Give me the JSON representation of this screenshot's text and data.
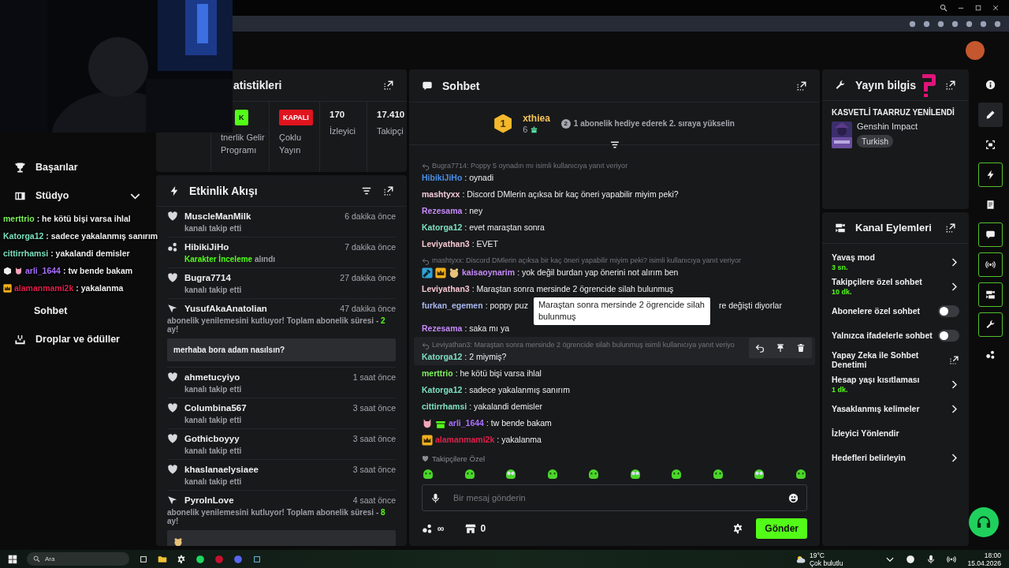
{
  "sidebar": {
    "items": [
      {
        "kind": "link",
        "label": "Başarılar"
      },
      {
        "kind": "group",
        "label": "Stüdyo",
        "expanded": false
      },
      {
        "kind": "subitem",
        "label": "Sohbet"
      },
      {
        "kind": "link",
        "label": "Droplar ve ödüller"
      }
    ]
  },
  "stream_overlay": {
    "lines": [
      {
        "user": "merttrio",
        "color": "#7cf25a",
        "text": " : he kötü bişi varsa ihlal"
      },
      {
        "user": "Katorga12",
        "color": "#7ee0c0",
        "text": " : sadece yakalanmış sanırım"
      },
      {
        "user": "cittirrhamsi",
        "color": "#7ee0c0",
        "text": " : yakalandi demisler"
      },
      {
        "badges": [
          {
            "kind": "cube"
          },
          {
            "kind": "sub"
          }
        ],
        "user": "arli_1644",
        "color": "#a970ff",
        "text": " : tw bende bakam"
      },
      {
        "badges": [
          {
            "kind": "vip"
          }
        ],
        "user": "alamanmami2k",
        "color": "#e0204a",
        "text": " : yakalanma"
      }
    ]
  },
  "stats": {
    "title": "atistikleri",
    "items": [
      {
        "kind": "badge",
        "value": "K",
        "color": "#53fc18",
        "label": "tnerlik Gelir Programı"
      },
      {
        "kind": "badge",
        "value": "KAPALI",
        "color": "#e0141e",
        "label": "Çoklu Yayın"
      },
      {
        "kind": "number",
        "value": "170",
        "label": "İzleyici"
      },
      {
        "kind": "number",
        "value": "17.410",
        "label": "Takipçi"
      }
    ]
  },
  "activity": {
    "title": "Etkinlik Akışı",
    "items": [
      {
        "kind": "follow",
        "user": "MuscleManMilk",
        "time": "6 dakika önce",
        "text": "kanalı takip etti"
      },
      {
        "kind": "reward",
        "user": "HibikiJiHo",
        "time": "7 dakika önce",
        "reward": "Karakter İnceleme",
        "text": "alındı"
      },
      {
        "kind": "follow",
        "user": "Bugra7714",
        "time": "27 dakika önce",
        "text": "kanalı takip etti"
      },
      {
        "kind": "subscription",
        "user": "YusufAkaAnatolian",
        "time": "47 dakika önce",
        "text": "abonelik yenilemesini kutluyor! Toplam abonelik süresi - ",
        "months": "2",
        "text_end": "ay!",
        "message": "merhaba bora adam nasılsın?"
      },
      {
        "kind": "follow",
        "user": "ahmetucyiyo",
        "time": "1 saat önce",
        "text": "kanalı takip etti"
      },
      {
        "kind": "follow",
        "user": "Columbina567",
        "time": "3 saat önce",
        "text": "kanalı takip etti"
      },
      {
        "kind": "follow",
        "user": "Gothicboyyy",
        "time": "3 saat önce",
        "text": "kanalı takip etti"
      },
      {
        "kind": "follow",
        "user": "khaslanaelysiaee",
        "time": "3 saat önce",
        "text": "kanalı takip etti"
      },
      {
        "kind": "subscription",
        "user": "PyroInLove",
        "time": "4 saat önce",
        "text": "abonelik yenilemesini kutluyor! Toplam abonelik süresi - ",
        "months": "8",
        "text_end": "ay!"
      }
    ]
  },
  "chat": {
    "title": "Sohbet",
    "leader": {
      "rank": "1",
      "user": "xthiea",
      "count": "6",
      "next_rank": "2",
      "hint": "1 abonelik hediye ederek 2. sıraya yükselin"
    },
    "messages": [
      {
        "reply": "Bugra7714: Poppy 5 oynadın mı isimli kullanıcıya yanıt veriyor",
        "user": "HibikiJiHo",
        "color": "#4a8fe7",
        "text": ": oynadi",
        "hovered": false
      },
      {
        "user": "mashtyxx",
        "color": "#f2c9d9",
        "text": ": Discord DMlerin açıksa bir kaç öneri yapabilir miyim peki?",
        "hovered": false
      },
      {
        "user": "Rezesama",
        "color": "#c58af9",
        "text": ": ney",
        "hovered": false
      },
      {
        "user": "Katorga12",
        "color": "#7ee0c0",
        "text": ": evet maraştan sonra",
        "hovered": false
      },
      {
        "user": "Leviyathan3",
        "color": "#f5c6d0",
        "text": ": EVET",
        "hovered": false
      },
      {
        "reply": "mashtyxx: Discord DMlerin açıksa bir kaç öneri yapabilir miyim peki? isimli kullanıcıya yanıt veriyor",
        "badges": [
          {
            "kind": "mod"
          },
          {
            "kind": "vip"
          },
          {
            "kind": "og"
          }
        ],
        "user": "kaisaoynarim",
        "color": "#c58af9",
        "text": ": yok değil burdan yap önerini not alırım ben",
        "hovered": false
      },
      {
        "user": "Leviyathan3",
        "color": "#f5c6d0",
        "text": ": Maraştan sonra mersinde 2 ögrencide silah bulunmuş",
        "hovered": false
      },
      {
        "user": "furkan_egemen",
        "color": "#a8b8f0",
        "text": ": poppy puz",
        "text_end": "re değişti diyorlar",
        "tooltip": "Maraştan sonra mersinde 2 ögrencide silah bulunmuş",
        "hovered": false
      },
      {
        "user": "Rezesama",
        "color": "#c58af9",
        "text": ": saka mı ya",
        "hovered": false
      },
      {
        "reply": "Leviyathan3: Maraştan sonra mersinde 2 ögrencide silah bulunmuş isimli kullanıcıya yanıt veriyo",
        "user": "Katorga12",
        "color": "#7ee0c0",
        "text": ": 2 miymiş?",
        "hovered": true
      },
      {
        "user": "merttrio",
        "color": "#7cf25a",
        "text": ": he kötü bişi varsa ihlal",
        "hovered": false
      },
      {
        "user": "Katorga12",
        "color": "#7ee0c0",
        "text": ": sadece yakalanmış sanırım",
        "hovered": false
      },
      {
        "user": "cittirrhamsi",
        "color": "#7ee0c0",
        "text": ": yakalandi demisler",
        "hovered": false
      },
      {
        "badges": [
          {
            "kind": "sub"
          },
          {
            "kind": "gift"
          }
        ],
        "user": "arli_1644",
        "color": "#a970ff",
        "text": ": tw bende bakam",
        "hovered": false
      },
      {
        "badges": [
          {
            "kind": "vip"
          }
        ],
        "user": "alamanmami2k",
        "color": "#e0204a",
        "text": ": yakalanma",
        "hovered": false
      }
    ],
    "emote_section": "Takipçilere Özel",
    "input": {
      "placeholder": "Bir mesaj gönderin"
    },
    "points": "∞",
    "store_count": "0",
    "send": "Gönder"
  },
  "stream_info": {
    "title": "Yayın bilgis",
    "stream_title": "KASVETLİ TAARRUZ YENİLENDİ",
    "category": "Genshin Impact",
    "tags": [
      "Turkish"
    ]
  },
  "channel_actions": {
    "title": "Kanal Eylemleri",
    "items": [
      {
        "kind": "menu",
        "label": "Yavaş mod",
        "value": "3 sn."
      },
      {
        "kind": "menu",
        "label": "Takipçilere özel sohbet",
        "value": "10 dk."
      },
      {
        "kind": "toggle",
        "label": "Abonelere özel sohbet",
        "on": false
      },
      {
        "kind": "toggle",
        "label": "Yalnızca ifadelerle sohbet",
        "on": false
      },
      {
        "kind": "external",
        "label": "Yapay Zeka ile Sohbet Denetimi"
      },
      {
        "kind": "menu",
        "label": "Hesap yaşı kısıtlaması",
        "value": "1 dk."
      },
      {
        "kind": "menu",
        "label": "Yasaklanmış kelimeler"
      },
      {
        "kind": "plain",
        "label": "İzleyici Yönlendir"
      },
      {
        "kind": "menu",
        "label": "Hedefleri belirleyin"
      }
    ]
  },
  "rail": [
    {
      "selected": false,
      "pinned": false
    },
    {
      "selected": true,
      "pinned": false
    },
    {
      "selected": false,
      "pinned": false
    },
    {
      "selected": false,
      "pinned": true
    },
    {
      "selected": false,
      "pinned": false
    },
    {
      "selected": false,
      "pinned": true
    },
    {
      "selected": false,
      "pinned": true
    },
    {
      "selected": false,
      "pinned": true
    },
    {
      "selected": false,
      "pinned": true
    },
    {
      "selected": false,
      "pinned": false
    }
  ],
  "taskbar": {
    "search": "Ara",
    "weather": {
      "temp": "19°C",
      "text": "Çok bulutlu"
    },
    "time": "18:00",
    "date": "15.04.2026"
  }
}
